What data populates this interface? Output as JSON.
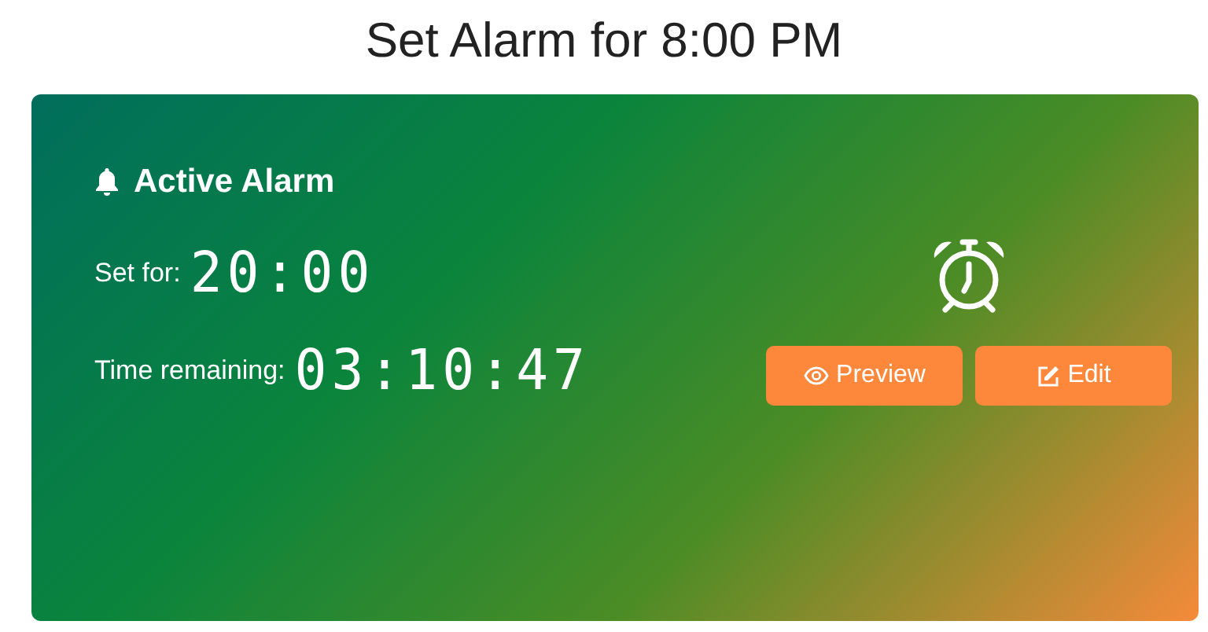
{
  "title": "Set Alarm for 8:00 PM",
  "card": {
    "heading": "Active Alarm",
    "set_for_label": "Set for:",
    "set_for_value": "20:00",
    "remaining_label": "Time remaining:",
    "remaining_value": "03:10:47",
    "buttons": [
      {
        "label": "Preview",
        "kind": "preview"
      },
      {
        "label": "Edit",
        "kind": "edit"
      }
    ]
  }
}
